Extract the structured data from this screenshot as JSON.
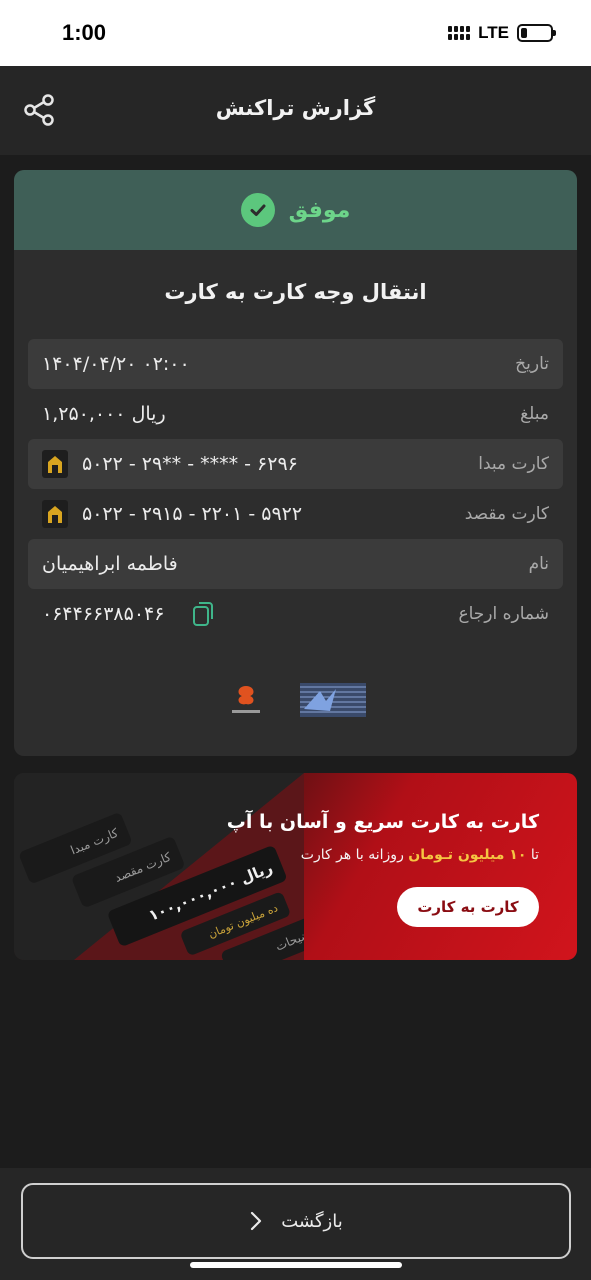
{
  "status_bar": {
    "time": "1:00",
    "network": "LTE"
  },
  "header": {
    "title": "گزارش تراکنش",
    "share_icon": "share-icon"
  },
  "receipt": {
    "status": "موفق",
    "status_color": "#6dd58a",
    "title": "انتقال وجه کارت به کارت",
    "rows": [
      {
        "label": "تاریخ",
        "value": "۱۴۰۴/۰۴/۲۰ ۰۲:۰۰"
      },
      {
        "label": "مبلغ",
        "value": "۱,۲۵۰,۰۰۰ ریال"
      },
      {
        "label": "کارت مبدا",
        "value": "۵۰۲۲ - ۲۹** - **** - ۶۲۹۶"
      },
      {
        "label": "کارت مقصد",
        "value": "۵۰۲۲ - ۲۹۱۵ - ۲۲۰۱ - ۵۹۲۲"
      },
      {
        "label": "نام",
        "value": "فاطمه ابراهیمیان"
      },
      {
        "label": "شماره ارجاع",
        "value": "۰۶۴۴۶۶۳۸۵۰۴۶"
      }
    ]
  },
  "promo": {
    "title": "کارت به کارت سریع و آسان با آپ",
    "subtitle_prefix": "تا",
    "subtitle_highlight": "۱۰ میلیون تـومان",
    "subtitle_suffix": "روزانه با هر کارت",
    "button": "کارت به کارت",
    "art": {
      "source_card": "کارت مبدا",
      "dest_card": "کارت مقصد",
      "amount": "۱۰۰,۰۰۰,۰۰۰ ریال",
      "amount_words": "ده میلیون تومان",
      "description": "توضیحات"
    }
  },
  "footer": {
    "back": "بازگشت"
  }
}
